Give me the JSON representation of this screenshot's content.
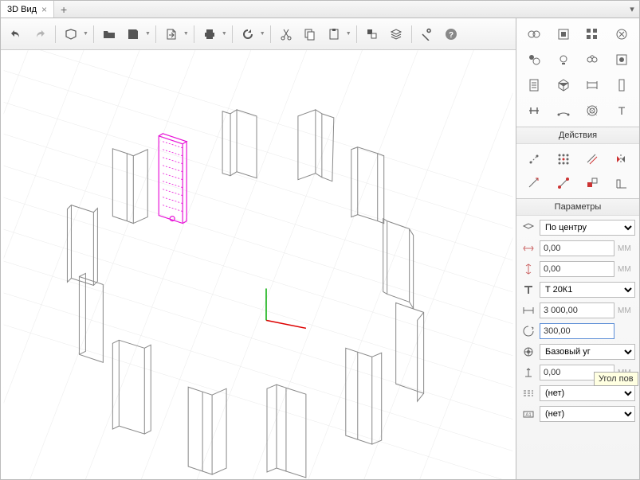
{
  "tabs": {
    "active": "3D Вид"
  },
  "panels": {
    "actions": "Действия",
    "params": "Параметры"
  },
  "params": {
    "alignment": "По центру",
    "offset_x": "0,00",
    "offset_y": "0,00",
    "profile": "T 20К1",
    "length": "3 000,00",
    "angle": "300,00",
    "basepoint": "Базовый уг",
    "elevation": "0,00",
    "line_style": "(нет)",
    "marking": "(нет)",
    "unit": "ММ"
  },
  "tooltip": "Угол пов"
}
